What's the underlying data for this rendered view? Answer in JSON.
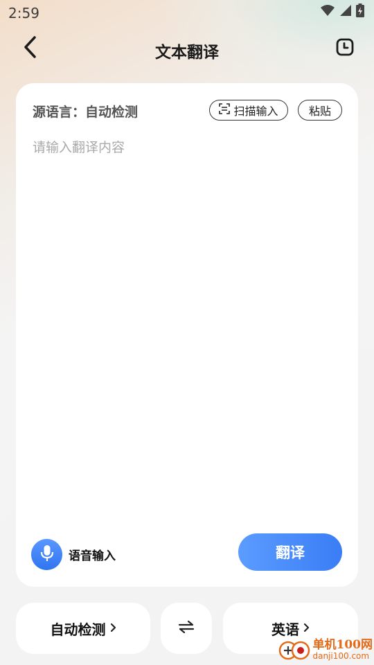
{
  "status_bar": {
    "time": "2:59",
    "icons": [
      "wifi-icon",
      "signal-icon",
      "battery-charging-icon"
    ]
  },
  "header": {
    "title": "文本翻译",
    "back_icon": "chevron-left-icon",
    "history_icon": "clock-icon"
  },
  "input_card": {
    "source_label": "源语言：",
    "source_value": "自动检测",
    "scan_button": "扫描输入",
    "paste_button": "粘贴",
    "input_value": "",
    "input_placeholder": "请输入翻译内容",
    "voice_label": "语音输入",
    "translate_button": "翻译"
  },
  "language_bar": {
    "from_lang": "自动检测",
    "swap_icon": "swap-arrows-icon",
    "to_lang": "英语"
  },
  "watermark": {
    "name": "单机100网",
    "url": "danji100.com"
  },
  "colors": {
    "accent": "#3a7df5",
    "watermark": "#e46a1a"
  }
}
